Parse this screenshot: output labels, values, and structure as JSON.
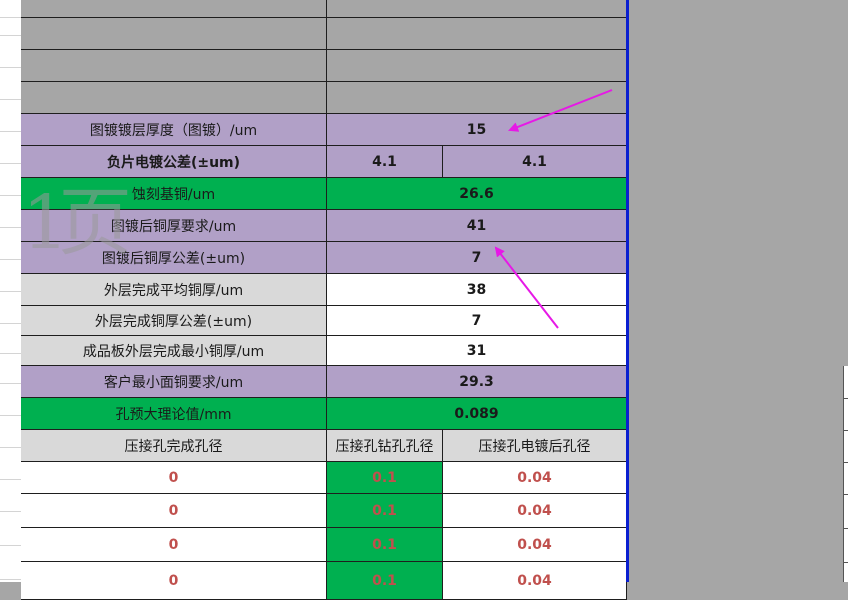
{
  "rows": [
    {
      "label": "",
      "values": [
        ""
      ],
      "bg": "gray"
    },
    {
      "label": "",
      "values": [
        ""
      ],
      "bg": "gray"
    },
    {
      "label": "",
      "values": [
        ""
      ],
      "bg": "gray"
    },
    {
      "label": "",
      "values": [
        ""
      ],
      "bg": "gray"
    },
    {
      "label": "图镀镀层厚度（图镀）/um",
      "values": [
        "15"
      ],
      "bg": "purple",
      "bold": false
    },
    {
      "label": "负片电镀公差(±um)",
      "values": [
        "4.1",
        "4.1"
      ],
      "bg": "purple",
      "bold": true
    },
    {
      "label": "蚀刻基铜/um",
      "values": [
        "26.6"
      ],
      "bg": "green",
      "bold": false
    },
    {
      "label": "图镀后铜厚要求/um",
      "values": [
        "41"
      ],
      "bg": "purple",
      "bold": false
    },
    {
      "label": "图镀后铜厚公差(±um)",
      "values": [
        "7"
      ],
      "bg": "purple",
      "bold": false
    },
    {
      "label": "外层完成平均铜厚/um",
      "values": [
        "38"
      ],
      "bg": "lgray",
      "valbg": "white",
      "bold": false
    },
    {
      "label": "外层完成铜厚公差(±um)",
      "values": [
        "7"
      ],
      "bg": "lgray",
      "valbg": "white",
      "bold": false
    },
    {
      "label": "成品板外层完成最小铜厚/um",
      "values": [
        "31"
      ],
      "bg": "lgray",
      "valbg": "white",
      "bold": false
    },
    {
      "label": "客户最小面铜要求/um",
      "values": [
        "29.3"
      ],
      "bg": "purple",
      "bold": false
    },
    {
      "label": "孔预大理论值/mm",
      "values": [
        "0.089"
      ],
      "bg": "green",
      "bold": false
    }
  ],
  "press_fit": {
    "headers": [
      "压接孔完成孔径",
      "压接孔钻孔孔径",
      "压接孔电镀后孔径"
    ],
    "rows": [
      [
        "0",
        "0.1",
        "0.04"
      ],
      [
        "0",
        "0.1",
        "0.04"
      ],
      [
        "0",
        "0.1",
        "0.04"
      ],
      [
        "0",
        "0.1",
        "0.04"
      ]
    ]
  },
  "watermark": {
    "glyph_a": "1",
    "glyph_b": "页"
  },
  "colors": {
    "gray": "#a6a6a6",
    "purple": "#b1a0c7",
    "green": "#00b050",
    "lgray": "#d9d9d9",
    "white": "#ffffff",
    "red_text": "#c0504d",
    "arrow": "#e619e6",
    "border_blue": "#0a1fd0"
  }
}
